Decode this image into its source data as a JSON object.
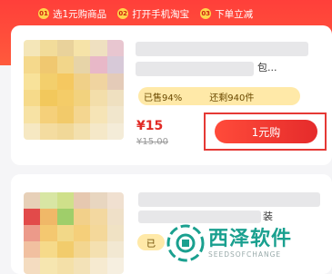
{
  "steps": [
    {
      "num": "01",
      "label": "选1元购商品"
    },
    {
      "num": "02",
      "label": "打开手机淘宝"
    },
    {
      "num": "03",
      "label": "下单立减"
    }
  ],
  "product1": {
    "title_tail": "包...",
    "sold": "已售94%",
    "remaining": "还剩940件",
    "price": "¥15",
    "original_price": "¥15.00",
    "buy_label": "1元购"
  },
  "product2": {
    "title_tail": "装",
    "sold_short": "已"
  },
  "watermark": {
    "main": "西泽软件",
    "sub": "SEEDSOFCHANGE"
  },
  "colors": {
    "brand": "#ff3f3a",
    "badge": "#ffd54a",
    "watermark": "#1aa08f"
  }
}
